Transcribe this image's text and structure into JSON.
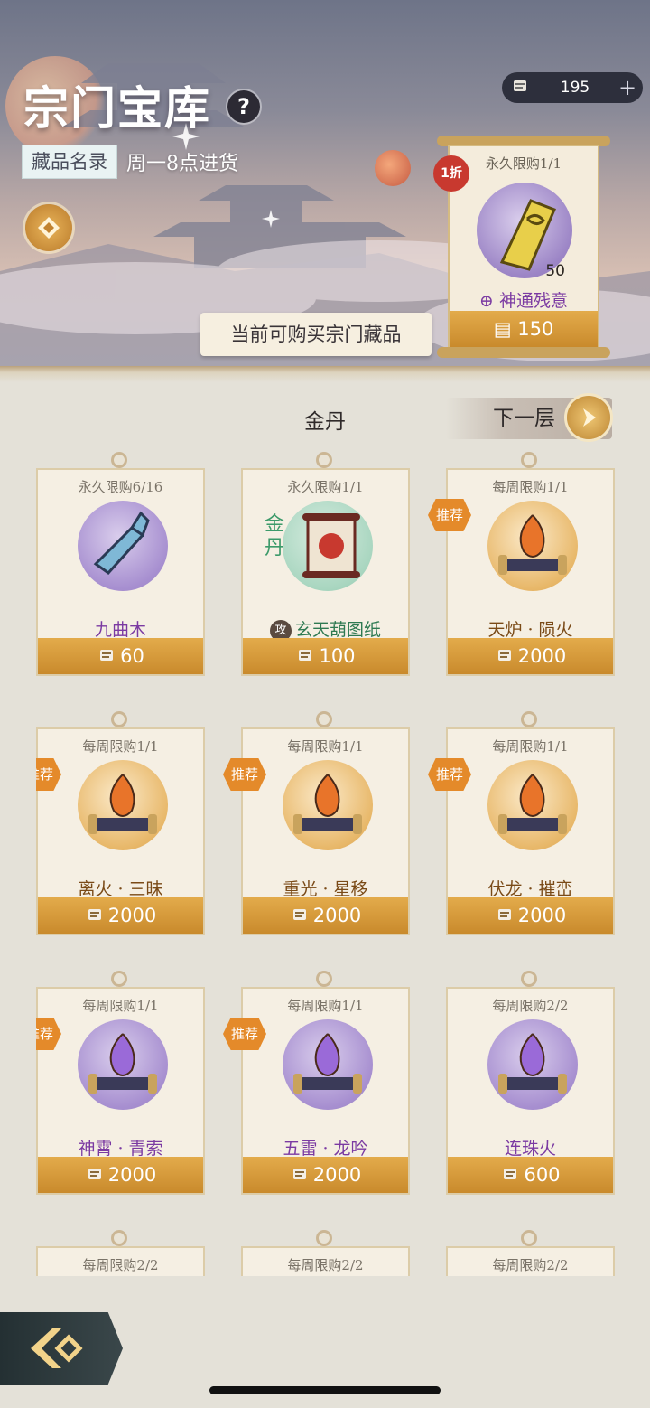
{
  "header": {
    "title": "宗门宝库",
    "help_icon": "question-icon",
    "tag": "藏品名录",
    "restock": "周一8点进货",
    "available_label": "当前可购买宗门藏品"
  },
  "currency": {
    "icon": "scroll-token-icon",
    "value": "195",
    "plus": "+"
  },
  "featured": {
    "discount": "1折",
    "limit": "永久限购1/1",
    "quantity": "50",
    "name": "神通残意",
    "price": "150"
  },
  "tier": {
    "title": "金丹",
    "next_label": "下一层"
  },
  "items": [
    {
      "limit": "永久限购6/16",
      "name": "九曲木",
      "price": "60",
      "recommended": false,
      "color": "purple"
    },
    {
      "limit": "永久限购1/1",
      "name": "玄天葫图纸",
      "price": "100",
      "recommended": false,
      "color": "green",
      "badge": "攻",
      "art_text": "金丹"
    },
    {
      "limit": "每周限购1/1",
      "name": "天炉 · 陨火",
      "price": "2000",
      "recommended": true,
      "color": "gold"
    },
    {
      "limit": "每周限购1/1",
      "name": "离火 · 三昧",
      "price": "2000",
      "recommended": true,
      "color": "gold"
    },
    {
      "limit": "每周限购1/1",
      "name": "重光 · 星移",
      "price": "2000",
      "recommended": true,
      "color": "gold"
    },
    {
      "limit": "每周限购1/1",
      "name": "伏龙 · 摧峦",
      "price": "2000",
      "recommended": true,
      "color": "gold"
    },
    {
      "limit": "每周限购1/1",
      "name": "神霄 · 青索",
      "price": "2000",
      "recommended": true,
      "color": "purple"
    },
    {
      "limit": "每周限购1/1",
      "name": "五雷 · 龙吟",
      "price": "2000",
      "recommended": true,
      "color": "purple"
    },
    {
      "limit": "每周限购2/2",
      "name": "连珠火",
      "price": "600",
      "recommended": false,
      "color": "purple"
    },
    {
      "limit": "每周限购2/2",
      "name": "",
      "price": "",
      "recommended": false,
      "color": "gold"
    },
    {
      "limit": "每周限购2/2",
      "name": "",
      "price": "",
      "recommended": false,
      "color": "gold"
    },
    {
      "limit": "每周限购2/2",
      "name": "",
      "price": "",
      "recommended": false,
      "color": "gold"
    }
  ],
  "recommend_label": "推荐",
  "colors": {
    "gold_bar": "#d69a3b",
    "purple_text": "#7b3aa2",
    "green_text": "#2f7a52",
    "recommend": "#e48a2a",
    "discount": "#c8392f"
  }
}
